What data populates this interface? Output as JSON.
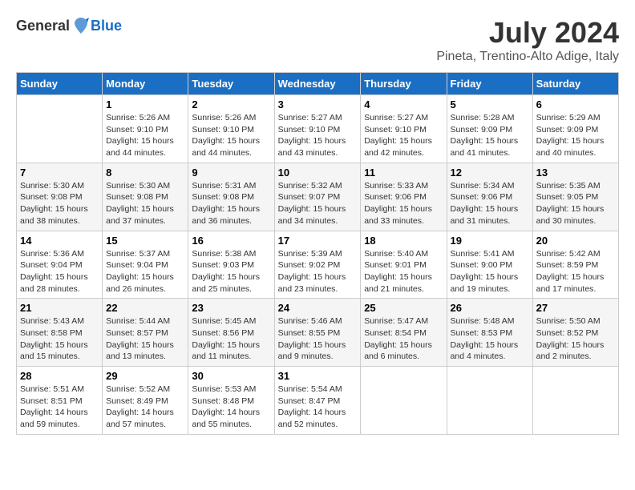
{
  "header": {
    "logo_general": "General",
    "logo_blue": "Blue",
    "month_year": "July 2024",
    "location": "Pineta, Trentino-Alto Adige, Italy"
  },
  "days_of_week": [
    "Sunday",
    "Monday",
    "Tuesday",
    "Wednesday",
    "Thursday",
    "Friday",
    "Saturday"
  ],
  "weeks": [
    [
      {
        "day": "",
        "info": ""
      },
      {
        "day": "1",
        "info": "Sunrise: 5:26 AM\nSunset: 9:10 PM\nDaylight: 15 hours\nand 44 minutes."
      },
      {
        "day": "2",
        "info": "Sunrise: 5:26 AM\nSunset: 9:10 PM\nDaylight: 15 hours\nand 44 minutes."
      },
      {
        "day": "3",
        "info": "Sunrise: 5:27 AM\nSunset: 9:10 PM\nDaylight: 15 hours\nand 43 minutes."
      },
      {
        "day": "4",
        "info": "Sunrise: 5:27 AM\nSunset: 9:10 PM\nDaylight: 15 hours\nand 42 minutes."
      },
      {
        "day": "5",
        "info": "Sunrise: 5:28 AM\nSunset: 9:09 PM\nDaylight: 15 hours\nand 41 minutes."
      },
      {
        "day": "6",
        "info": "Sunrise: 5:29 AM\nSunset: 9:09 PM\nDaylight: 15 hours\nand 40 minutes."
      }
    ],
    [
      {
        "day": "7",
        "info": "Sunrise: 5:30 AM\nSunset: 9:08 PM\nDaylight: 15 hours\nand 38 minutes."
      },
      {
        "day": "8",
        "info": "Sunrise: 5:30 AM\nSunset: 9:08 PM\nDaylight: 15 hours\nand 37 minutes."
      },
      {
        "day": "9",
        "info": "Sunrise: 5:31 AM\nSunset: 9:08 PM\nDaylight: 15 hours\nand 36 minutes."
      },
      {
        "day": "10",
        "info": "Sunrise: 5:32 AM\nSunset: 9:07 PM\nDaylight: 15 hours\nand 34 minutes."
      },
      {
        "day": "11",
        "info": "Sunrise: 5:33 AM\nSunset: 9:06 PM\nDaylight: 15 hours\nand 33 minutes."
      },
      {
        "day": "12",
        "info": "Sunrise: 5:34 AM\nSunset: 9:06 PM\nDaylight: 15 hours\nand 31 minutes."
      },
      {
        "day": "13",
        "info": "Sunrise: 5:35 AM\nSunset: 9:05 PM\nDaylight: 15 hours\nand 30 minutes."
      }
    ],
    [
      {
        "day": "14",
        "info": "Sunrise: 5:36 AM\nSunset: 9:04 PM\nDaylight: 15 hours\nand 28 minutes."
      },
      {
        "day": "15",
        "info": "Sunrise: 5:37 AM\nSunset: 9:04 PM\nDaylight: 15 hours\nand 26 minutes."
      },
      {
        "day": "16",
        "info": "Sunrise: 5:38 AM\nSunset: 9:03 PM\nDaylight: 15 hours\nand 25 minutes."
      },
      {
        "day": "17",
        "info": "Sunrise: 5:39 AM\nSunset: 9:02 PM\nDaylight: 15 hours\nand 23 minutes."
      },
      {
        "day": "18",
        "info": "Sunrise: 5:40 AM\nSunset: 9:01 PM\nDaylight: 15 hours\nand 21 minutes."
      },
      {
        "day": "19",
        "info": "Sunrise: 5:41 AM\nSunset: 9:00 PM\nDaylight: 15 hours\nand 19 minutes."
      },
      {
        "day": "20",
        "info": "Sunrise: 5:42 AM\nSunset: 8:59 PM\nDaylight: 15 hours\nand 17 minutes."
      }
    ],
    [
      {
        "day": "21",
        "info": "Sunrise: 5:43 AM\nSunset: 8:58 PM\nDaylight: 15 hours\nand 15 minutes."
      },
      {
        "day": "22",
        "info": "Sunrise: 5:44 AM\nSunset: 8:57 PM\nDaylight: 15 hours\nand 13 minutes."
      },
      {
        "day": "23",
        "info": "Sunrise: 5:45 AM\nSunset: 8:56 PM\nDaylight: 15 hours\nand 11 minutes."
      },
      {
        "day": "24",
        "info": "Sunrise: 5:46 AM\nSunset: 8:55 PM\nDaylight: 15 hours\nand 9 minutes."
      },
      {
        "day": "25",
        "info": "Sunrise: 5:47 AM\nSunset: 8:54 PM\nDaylight: 15 hours\nand 6 minutes."
      },
      {
        "day": "26",
        "info": "Sunrise: 5:48 AM\nSunset: 8:53 PM\nDaylight: 15 hours\nand 4 minutes."
      },
      {
        "day": "27",
        "info": "Sunrise: 5:50 AM\nSunset: 8:52 PM\nDaylight: 15 hours\nand 2 minutes."
      }
    ],
    [
      {
        "day": "28",
        "info": "Sunrise: 5:51 AM\nSunset: 8:51 PM\nDaylight: 14 hours\nand 59 minutes."
      },
      {
        "day": "29",
        "info": "Sunrise: 5:52 AM\nSunset: 8:49 PM\nDaylight: 14 hours\nand 57 minutes."
      },
      {
        "day": "30",
        "info": "Sunrise: 5:53 AM\nSunset: 8:48 PM\nDaylight: 14 hours\nand 55 minutes."
      },
      {
        "day": "31",
        "info": "Sunrise: 5:54 AM\nSunset: 8:47 PM\nDaylight: 14 hours\nand 52 minutes."
      },
      {
        "day": "",
        "info": ""
      },
      {
        "day": "",
        "info": ""
      },
      {
        "day": "",
        "info": ""
      }
    ]
  ]
}
